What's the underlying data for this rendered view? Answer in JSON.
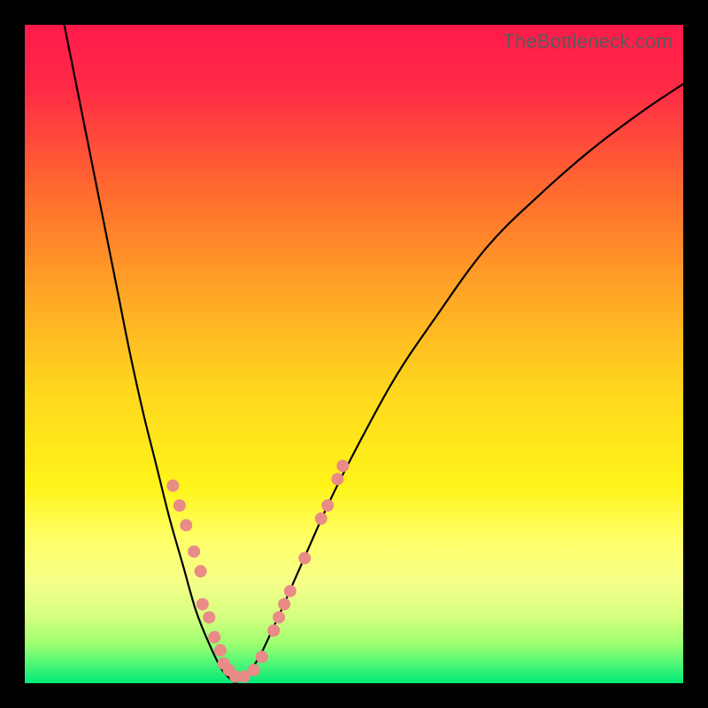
{
  "watermark": "TheBottleneck.com",
  "chart_data": {
    "type": "line",
    "title": "",
    "xlabel": "",
    "ylabel": "",
    "xlim": [
      0,
      100
    ],
    "ylim": [
      0,
      100
    ],
    "grid": false,
    "legend": false,
    "background": {
      "stops": [
        {
          "pos": 0.0,
          "color": "#ff1a4b"
        },
        {
          "pos": 0.1,
          "color": "#ff2b46"
        },
        {
          "pos": 0.25,
          "color": "#ff6a2f"
        },
        {
          "pos": 0.4,
          "color": "#ffa326"
        },
        {
          "pos": 0.55,
          "color": "#ffd61e"
        },
        {
          "pos": 0.7,
          "color": "#fff41a"
        },
        {
          "pos": 0.78,
          "color": "#ffff66"
        },
        {
          "pos": 0.85,
          "color": "#f4ff8a"
        },
        {
          "pos": 0.9,
          "color": "#d4ff7f"
        },
        {
          "pos": 0.94,
          "color": "#9cff70"
        },
        {
          "pos": 0.97,
          "color": "#50f776"
        },
        {
          "pos": 1.0,
          "color": "#00e876"
        }
      ]
    },
    "series": [
      {
        "name": "left-branch",
        "stroke": "#000000",
        "points": [
          {
            "x": 6,
            "y": 100
          },
          {
            "x": 8,
            "y": 90
          },
          {
            "x": 10,
            "y": 80
          },
          {
            "x": 12,
            "y": 70
          },
          {
            "x": 14,
            "y": 60
          },
          {
            "x": 16,
            "y": 50
          },
          {
            "x": 18,
            "y": 41
          },
          {
            "x": 20,
            "y": 33
          },
          {
            "x": 22,
            "y": 25
          },
          {
            "x": 24,
            "y": 18
          },
          {
            "x": 26,
            "y": 11
          },
          {
            "x": 28,
            "y": 6
          },
          {
            "x": 30,
            "y": 2
          },
          {
            "x": 32,
            "y": 0
          }
        ]
      },
      {
        "name": "right-branch",
        "stroke": "#000000",
        "points": [
          {
            "x": 32,
            "y": 0
          },
          {
            "x": 35,
            "y": 3
          },
          {
            "x": 38,
            "y": 9
          },
          {
            "x": 42,
            "y": 18
          },
          {
            "x": 46,
            "y": 27
          },
          {
            "x": 50,
            "y": 35
          },
          {
            "x": 56,
            "y": 46
          },
          {
            "x": 62,
            "y": 55
          },
          {
            "x": 70,
            "y": 66
          },
          {
            "x": 78,
            "y": 74
          },
          {
            "x": 86,
            "y": 81
          },
          {
            "x": 94,
            "y": 87
          },
          {
            "x": 100,
            "y": 91
          }
        ]
      }
    ],
    "markers": {
      "color": "#e98b87",
      "radius": 7,
      "points": [
        {
          "x": 22.5,
          "y": 30
        },
        {
          "x": 23.5,
          "y": 27
        },
        {
          "x": 24.5,
          "y": 24
        },
        {
          "x": 25.7,
          "y": 20
        },
        {
          "x": 26.7,
          "y": 17
        },
        {
          "x": 27.0,
          "y": 12
        },
        {
          "x": 28.0,
          "y": 10
        },
        {
          "x": 28.8,
          "y": 7
        },
        {
          "x": 29.7,
          "y": 5
        },
        {
          "x": 30.2,
          "y": 3
        },
        {
          "x": 31.0,
          "y": 2
        },
        {
          "x": 32.0,
          "y": 1
        },
        {
          "x": 33.3,
          "y": 1
        },
        {
          "x": 34.8,
          "y": 2
        },
        {
          "x": 36.0,
          "y": 4
        },
        {
          "x": 37.8,
          "y": 8
        },
        {
          "x": 38.6,
          "y": 10
        },
        {
          "x": 39.4,
          "y": 12
        },
        {
          "x": 40.3,
          "y": 14
        },
        {
          "x": 42.5,
          "y": 19
        },
        {
          "x": 45.0,
          "y": 25
        },
        {
          "x": 46.0,
          "y": 27
        },
        {
          "x": 47.5,
          "y": 31
        },
        {
          "x": 48.3,
          "y": 33
        }
      ]
    }
  }
}
